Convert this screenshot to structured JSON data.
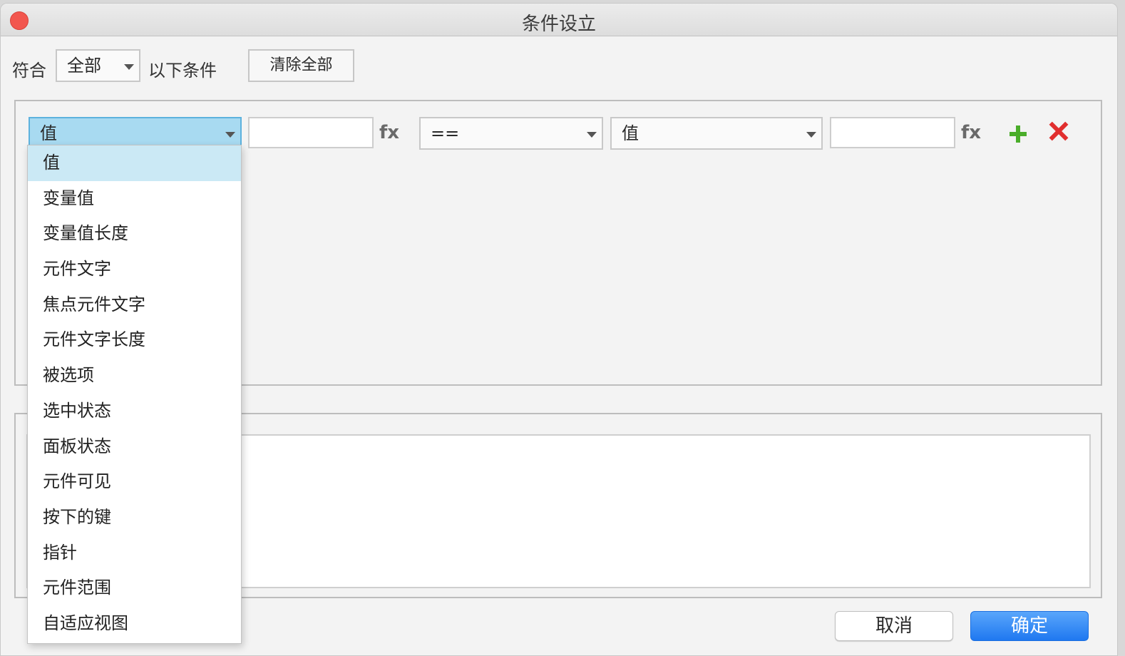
{
  "window": {
    "title": "条件设立"
  },
  "header": {
    "match_label": "符合",
    "match_select_value": "全部",
    "match_suffix": "以下条件",
    "clear_all_label": "清除全部"
  },
  "condition_row": {
    "left_select_value": "值",
    "left_input_value": "",
    "fx_label": "fx",
    "operator_value": "==",
    "right_select_value": "值",
    "right_input_value": "",
    "add_icon": "plus-icon",
    "delete_icon": "x-icon"
  },
  "dropdown": {
    "items": [
      "值",
      "变量值",
      "变量值长度",
      "元件文字",
      "焦点元件文字",
      "元件文字长度",
      "被选项",
      "选中状态",
      "面板状态",
      "元件可见",
      "按下的键",
      "指针",
      "元件范围",
      "自适应视图"
    ],
    "selected_index": 0
  },
  "footer": {
    "cancel_label": "取消",
    "ok_label": "确定"
  },
  "colors": {
    "accent": "#1f78f0",
    "selected_bg": "#a8daf1",
    "add": "#4aad2a",
    "delete": "#e12e2e",
    "close": "#f2564e"
  }
}
